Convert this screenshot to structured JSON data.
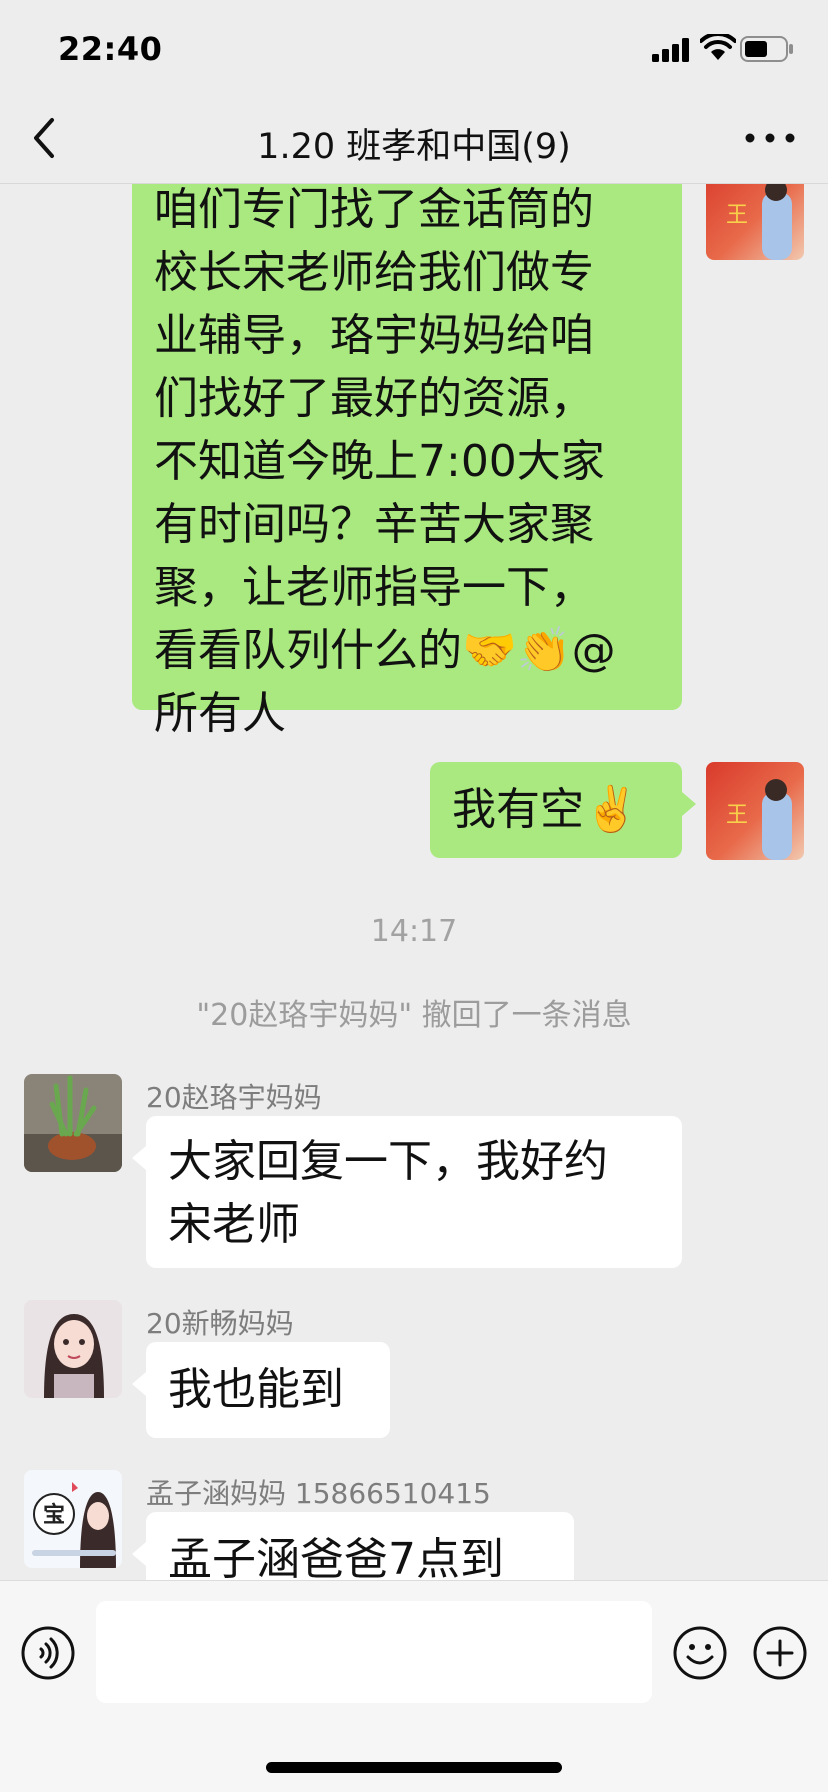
{
  "status_bar": {
    "time": "22:40"
  },
  "header": {
    "title": "1.20 班孝和中国",
    "member_count": "(9)"
  },
  "messages": [
    {
      "sender": "self",
      "lines": [
        "咱们专门找了金话筒的",
        "校长宋老师给我们做专",
        "业辅导，珞宇妈妈给咱",
        "们找好了最好的资源，",
        "不知道今晚上7:00大家",
        "有时间吗？辛苦大家聚",
        "聚，让老师指导一下，",
        "看看队列什么的🤝👏@",
        "所有人"
      ]
    },
    {
      "sender": "self",
      "lines": [
        "我有空✌️"
      ]
    },
    {
      "timestamp": "14:17"
    },
    {
      "recall_notice": "\"20赵珞宇妈妈\" 撤回了一条消息"
    },
    {
      "sender": "20赵珞宇妈妈",
      "lines": [
        "大家回复一下，我好约",
        "宋老师"
      ]
    },
    {
      "sender": "20新畅妈妈",
      "lines": [
        "我也能到"
      ]
    },
    {
      "sender": "孟子涵妈妈 15866510415",
      "lines": [
        "孟子涵爸爸7点到"
      ]
    }
  ],
  "input": {
    "placeholder": ""
  },
  "icons": {
    "back": "chevron-left-icon",
    "more": "more-horizontal-icon",
    "voice": "voice-icon",
    "emoji": "emoji-icon",
    "plus": "plus-icon"
  },
  "colors": {
    "self_bubble": "#a9e97f",
    "other_bubble": "#ffffff",
    "background": "#ededed"
  },
  "avatar_badge": {
    "self_text": "王",
    "baby_badge_text": "宝"
  }
}
